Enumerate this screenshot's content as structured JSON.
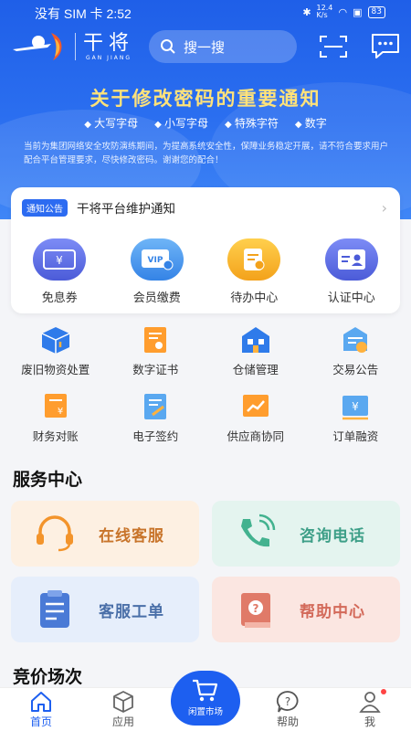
{
  "status_bar": {
    "carrier_time": "没有 SIM 卡 2:52",
    "network_speed": "12.4 K/s",
    "battery": "83"
  },
  "header": {
    "logo_text": "干将",
    "logo_sub": "GAN JIANG",
    "search_placeholder": "搜一搜"
  },
  "banner": {
    "title": "关于修改密码的重要通知",
    "tags": [
      "大写字母",
      "小写字母",
      "特殊字符",
      "数字"
    ],
    "body": "当前为集团网络安全攻防演练期间，为提高系统安全性，保障业务稳定开展，请不符合要求用户配合平台管理要求，尽快修改密码。谢谢您的配合！"
  },
  "announcement": {
    "badge": "通知公告",
    "text": "干将平台维护通知"
  },
  "main_icons": [
    {
      "label": "免息券",
      "icon": "coupon-icon"
    },
    {
      "label": "会员缴费",
      "icon": "vip-card-icon"
    },
    {
      "label": "待办中心",
      "icon": "todo-icon"
    },
    {
      "label": "认证中心",
      "icon": "id-card-icon"
    }
  ],
  "grid_rows": [
    [
      {
        "label": "废旧物资处置",
        "icon": "box-icon"
      },
      {
        "label": "数字证书",
        "icon": "certificate-icon"
      },
      {
        "label": "仓储管理",
        "icon": "warehouse-icon"
      },
      {
        "label": "交易公告",
        "icon": "announcement-icon"
      }
    ],
    [
      {
        "label": "财务对账",
        "icon": "finance-icon"
      },
      {
        "label": "电子签约",
        "icon": "esign-icon"
      },
      {
        "label": "供应商协同",
        "icon": "chart-icon"
      },
      {
        "label": "订单融资",
        "icon": "financing-icon"
      }
    ]
  ],
  "service_center": {
    "title": "服务中心",
    "items": [
      {
        "label": "在线客服",
        "icon": "headset-icon",
        "color": "#c8742a"
      },
      {
        "label": "咨询电话",
        "icon": "phone-icon",
        "color": "#3e9f88"
      },
      {
        "label": "客服工单",
        "icon": "clipboard-icon",
        "color": "#4a6fa8"
      },
      {
        "label": "帮助中心",
        "icon": "help-book-icon",
        "color": "#d36a5a"
      }
    ]
  },
  "bidding": {
    "title": "竞价场次"
  },
  "tabs": [
    {
      "label": "首页",
      "icon": "home-icon",
      "active": true
    },
    {
      "label": "应用",
      "icon": "cube-icon",
      "active": false
    },
    {
      "label": "闲置市场",
      "icon": "cart-icon",
      "active": false
    },
    {
      "label": "帮助",
      "icon": "help-chat-icon",
      "active": false
    },
    {
      "label": "我",
      "icon": "user-icon",
      "active": false
    }
  ],
  "colors": {
    "primary": "#1d5ff0",
    "banner_title": "#ffe27a"
  }
}
